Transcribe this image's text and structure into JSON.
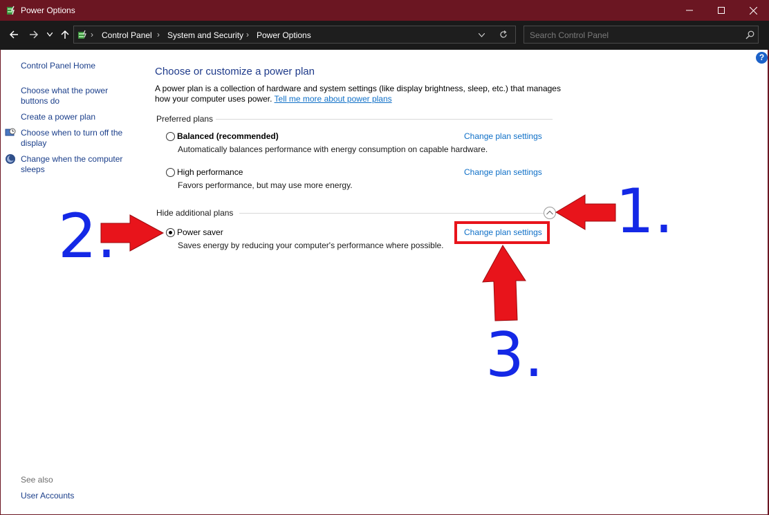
{
  "window": {
    "title": "Power Options",
    "minimize_icon": "minimize-icon",
    "maximize_icon": "maximize-icon",
    "close_icon": "close-icon"
  },
  "address_bar": {
    "breadcrumbs": [
      "Control Panel",
      "System and Security",
      "Power Options"
    ],
    "search_placeholder": "Search Control Panel"
  },
  "sidebar": {
    "home": "Control Panel Home",
    "items": [
      {
        "label_1": "Choose what the power",
        "label_2": "buttons do"
      },
      {
        "label_1": "Create a power plan"
      },
      {
        "label_1": "Choose when to turn off the",
        "label_2": "display"
      },
      {
        "label_1": "Change when the computer",
        "label_2": "sleeps"
      }
    ],
    "see_also": "See also",
    "user_accounts": "User Accounts"
  },
  "main": {
    "title": "Choose or customize a power plan",
    "description_line1": "A power plan is a collection of hardware and system settings (like display brightness, sleep, etc.) that manages",
    "description_line2": "how your computer uses power.",
    "learn_more": "Tell me more about power plans",
    "preferred_header": "Preferred plans",
    "additional_header": "Hide additional plans",
    "change_link": "Change plan settings",
    "plans": [
      {
        "name": "Balanced (recommended)",
        "description": "Automatically balances performance with energy consumption on capable hardware.",
        "selected": false
      },
      {
        "name": "High performance",
        "description": "Favors performance, but may use more energy.",
        "selected": false
      },
      {
        "name": "Power saver",
        "description": "Saves energy by reducing your computer's performance where possible.",
        "selected": true
      }
    ]
  },
  "annotations": {
    "step1": "1.",
    "step2": "2.",
    "step3": "3.",
    "arrow_color": "#e8141b",
    "number_color": "#1428e6"
  },
  "colors": {
    "titlebar": "#6b1622",
    "link": "#0e6fc7"
  }
}
